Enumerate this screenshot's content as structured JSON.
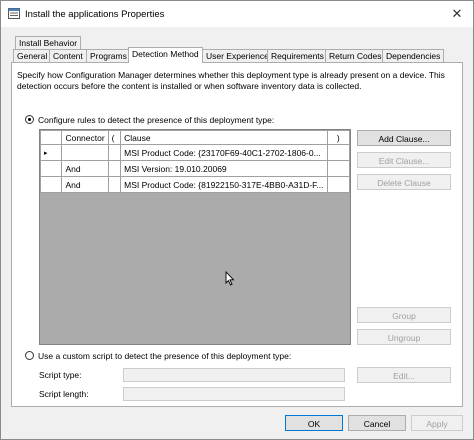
{
  "window": {
    "title": "Install the applications Properties",
    "close_glyph": "✕"
  },
  "tabs_row1": [
    {
      "label": "Install Behavior"
    }
  ],
  "tabs_row2": [
    {
      "label": "General"
    },
    {
      "label": "Content"
    },
    {
      "label": "Programs"
    },
    {
      "label": "Detection Method",
      "active": true
    },
    {
      "label": "User Experience"
    },
    {
      "label": "Requirements"
    },
    {
      "label": "Return Codes"
    },
    {
      "label": "Dependencies"
    }
  ],
  "detection": {
    "description_line1": "Specify how Configuration Manager determines whether this deployment type is already present on a device. This",
    "description_line2": "detection occurs before the content is installed or when software inventory data is collected.",
    "rules_option": "Configure rules to detect the presence of this deployment type:",
    "script_option": "Use a custom script to detect the presence of this deployment type:",
    "rules_selected": true
  },
  "grid": {
    "columns": [
      "",
      "Connector",
      "(",
      "Clause",
      ")"
    ],
    "row_marker": "▸",
    "rows": [
      {
        "connector": "",
        "open": "",
        "clause": "MSI Product Code: {23170F69-40C1-2702-1806-0...",
        "close": ""
      },
      {
        "connector": "And",
        "open": "",
        "clause": "MSI Version: 19.010.20069",
        "close": ""
      },
      {
        "connector": "And",
        "open": "",
        "clause": "MSI Product Code: {81922150-317E-4BB0-A31D-F...",
        "close": ""
      }
    ]
  },
  "side_buttons": {
    "add": "Add Clause...",
    "edit": "Edit Clause...",
    "delete": "Delete Clause",
    "group": "Group",
    "ungroup": "Ungroup",
    "script_edit": "Edit..."
  },
  "script_fields": {
    "type_label": "Script type:",
    "length_label": "Script length:"
  },
  "footer": {
    "ok": "OK",
    "cancel": "Cancel",
    "apply": "Apply"
  },
  "colors": {
    "accent": "#0078d7",
    "disabled_text": "#a0a0a0"
  },
  "icons": [
    "properties-window-icon",
    "close-icon",
    "row-pointer-icon",
    "mouse-cursor-icon"
  ]
}
